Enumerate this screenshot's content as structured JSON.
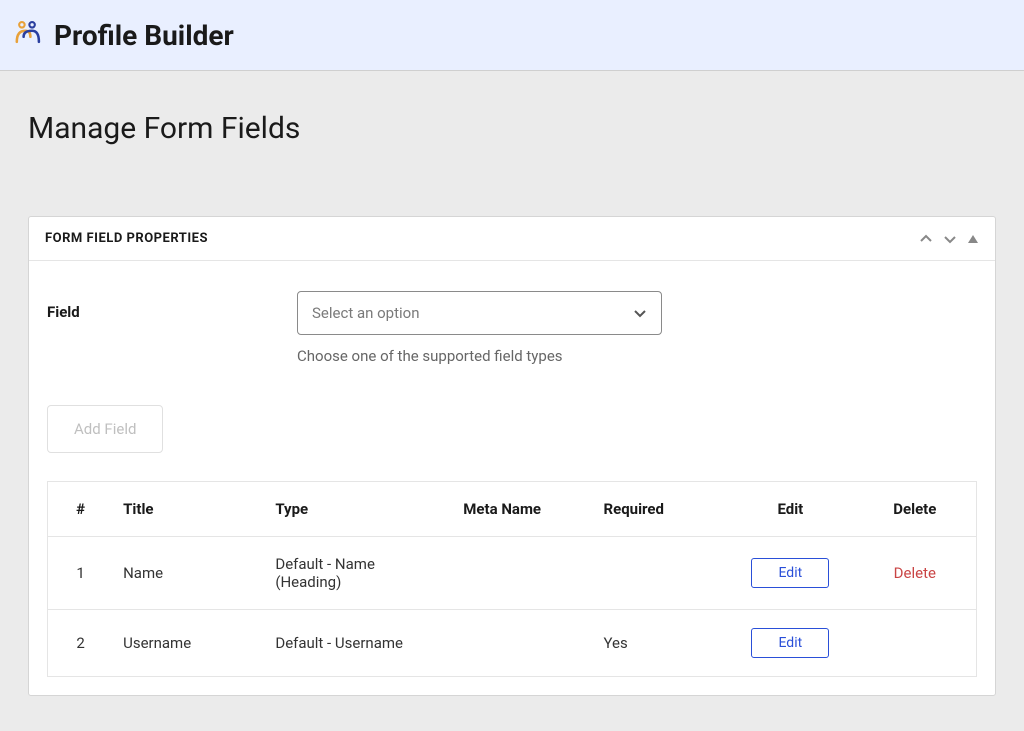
{
  "header": {
    "app_title": "Profile Builder"
  },
  "page": {
    "title": "Manage Form Fields"
  },
  "panel": {
    "title": "FORM FIELD PROPERTIES"
  },
  "field": {
    "label": "Field",
    "select_placeholder": "Select an option",
    "help_text": "Choose one of the supported field types"
  },
  "buttons": {
    "add_field": "Add Field",
    "edit": "Edit",
    "delete": "Delete"
  },
  "table": {
    "headers": {
      "num": "#",
      "title": "Title",
      "type": "Type",
      "meta_name": "Meta Name",
      "required": "Required",
      "edit": "Edit",
      "delete": "Delete"
    },
    "rows": [
      {
        "num": "1",
        "title": "Name",
        "type": "Default - Name (Heading)",
        "meta_name": "",
        "required": "",
        "show_delete": true
      },
      {
        "num": "2",
        "title": "Username",
        "type": "Default - Username",
        "meta_name": "",
        "required": "Yes",
        "show_delete": false
      }
    ]
  }
}
